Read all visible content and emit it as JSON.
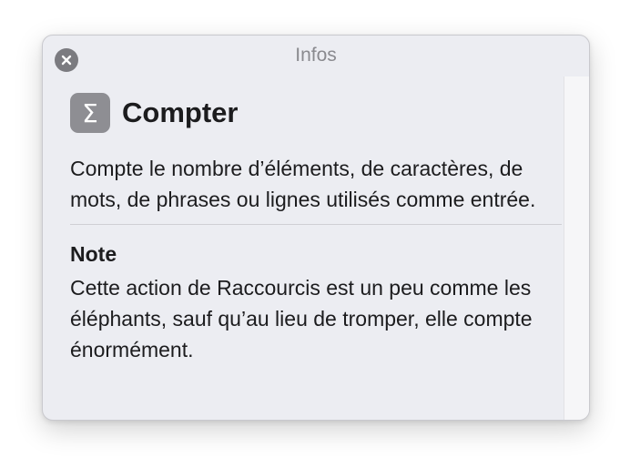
{
  "window": {
    "title": "Infos"
  },
  "action": {
    "icon_symbol": "Σ",
    "icon_name": "sigma-icon",
    "name": "Compter",
    "description": "Compte le nombre d’éléments, de caractères, de mots, de phrases ou lignes utilisés comme entrée."
  },
  "note": {
    "heading": "Note",
    "body": "Cette action de Raccourcis est un peu comme les éléphants, sauf qu’au lieu de tromper, elle compte énormément."
  },
  "colors": {
    "panel_background": "#ecedf2",
    "icon_background": "#8e8e93",
    "close_button": "#7b7b80",
    "text": "#1c1c1e",
    "title_text": "#8a8a8f"
  }
}
